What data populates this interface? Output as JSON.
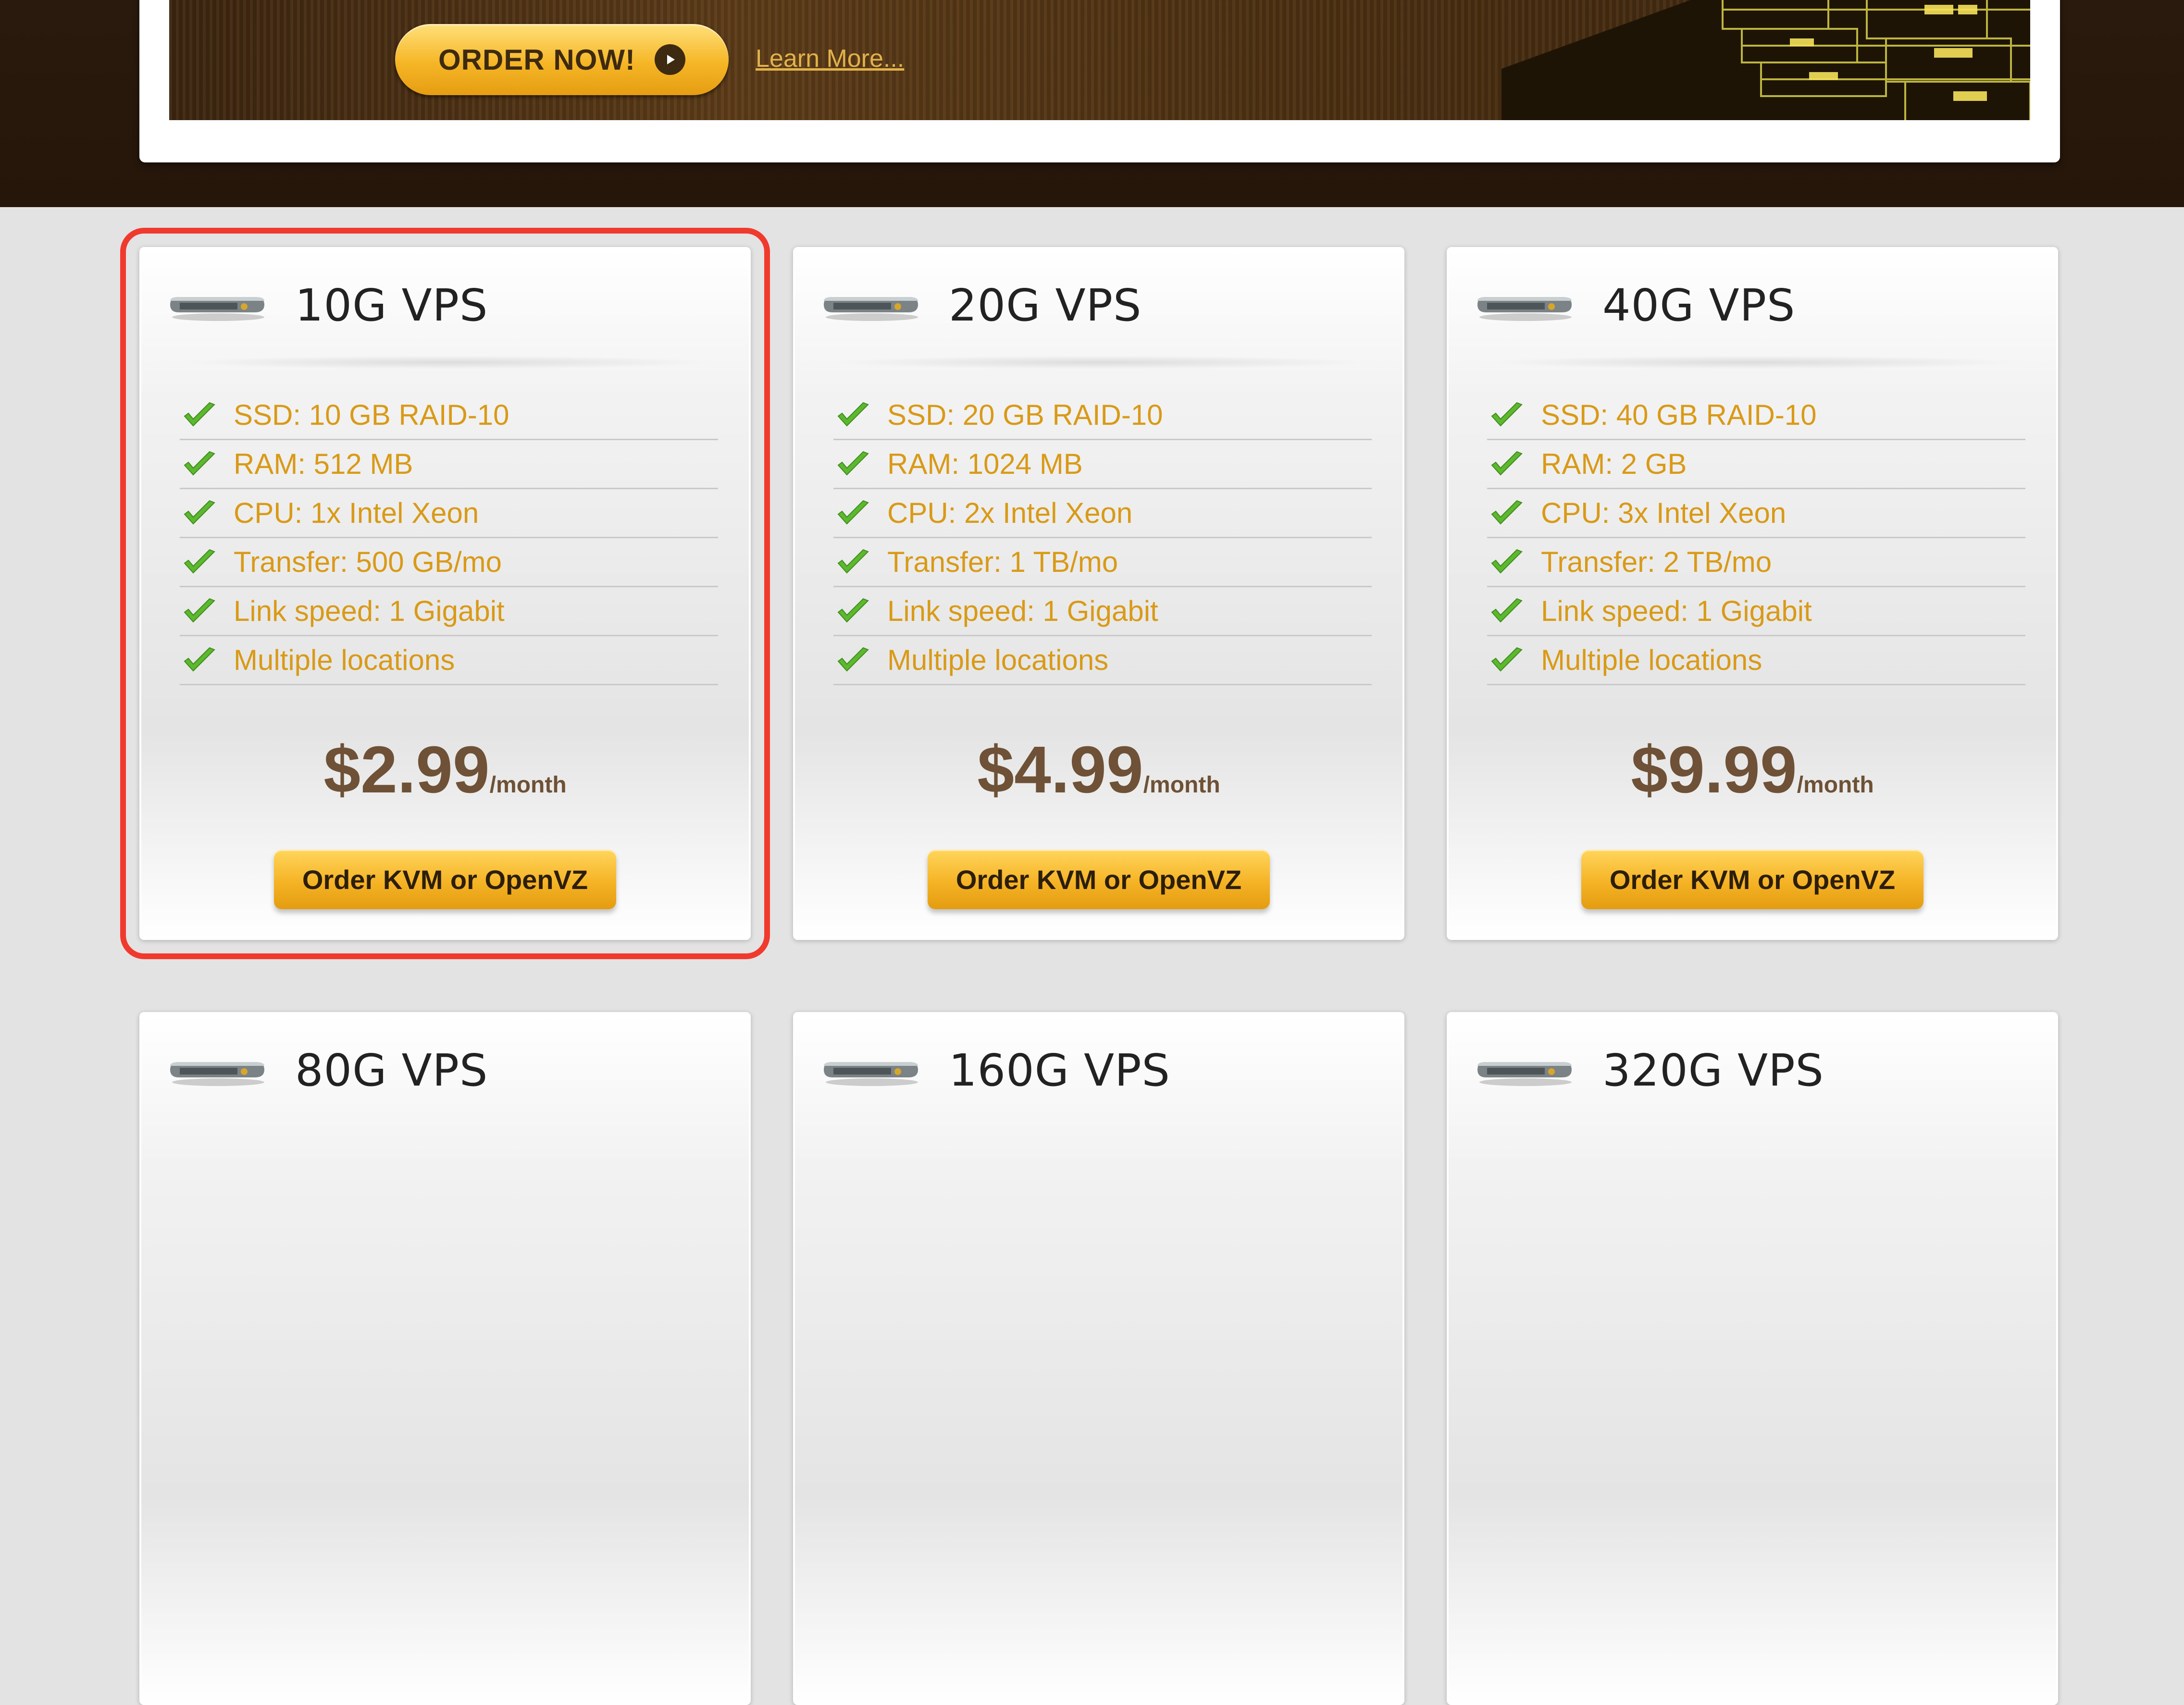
{
  "banner": {
    "order_now_label": "ORDER NOW!",
    "learn_more_label": "Learn More..."
  },
  "plans": [
    {
      "title": "10G VPS",
      "features": [
        "SSD: 10 GB RAID-10",
        "RAM: 512 MB",
        "CPU: 1x Intel Xeon",
        "Transfer: 500 GB/mo",
        "Link speed: 1 Gigabit",
        "Multiple locations"
      ],
      "price": "$2.99",
      "period": "/month",
      "button_label": "Order KVM or OpenVZ"
    },
    {
      "title": "20G VPS",
      "features": [
        "SSD: 20 GB RAID-10",
        "RAM: 1024 MB",
        "CPU: 2x Intel Xeon",
        "Transfer: 1 TB/mo",
        "Link speed: 1 Gigabit",
        "Multiple locations"
      ],
      "price": "$4.99",
      "period": "/month",
      "button_label": "Order KVM or OpenVZ"
    },
    {
      "title": "40G VPS",
      "features": [
        "SSD: 40 GB RAID-10",
        "RAM: 2 GB",
        "CPU: 3x Intel Xeon",
        "Transfer: 2 TB/mo",
        "Link speed: 1 Gigabit",
        "Multiple locations"
      ],
      "price": "$9.99",
      "period": "/month",
      "button_label": "Order KVM or OpenVZ"
    },
    {
      "title": "80G VPS"
    },
    {
      "title": "160G VPS"
    },
    {
      "title": "320G VPS"
    }
  ],
  "colors": {
    "accent_gold": "#f5b326",
    "feature_text": "#d99a17",
    "price_text": "#6e5136",
    "highlight_border": "#f03a2e",
    "header_dark": "#2a1a0e"
  },
  "icons": {
    "feature": "check-icon",
    "plan": "server-disk-icon",
    "order_now": "play-icon"
  }
}
